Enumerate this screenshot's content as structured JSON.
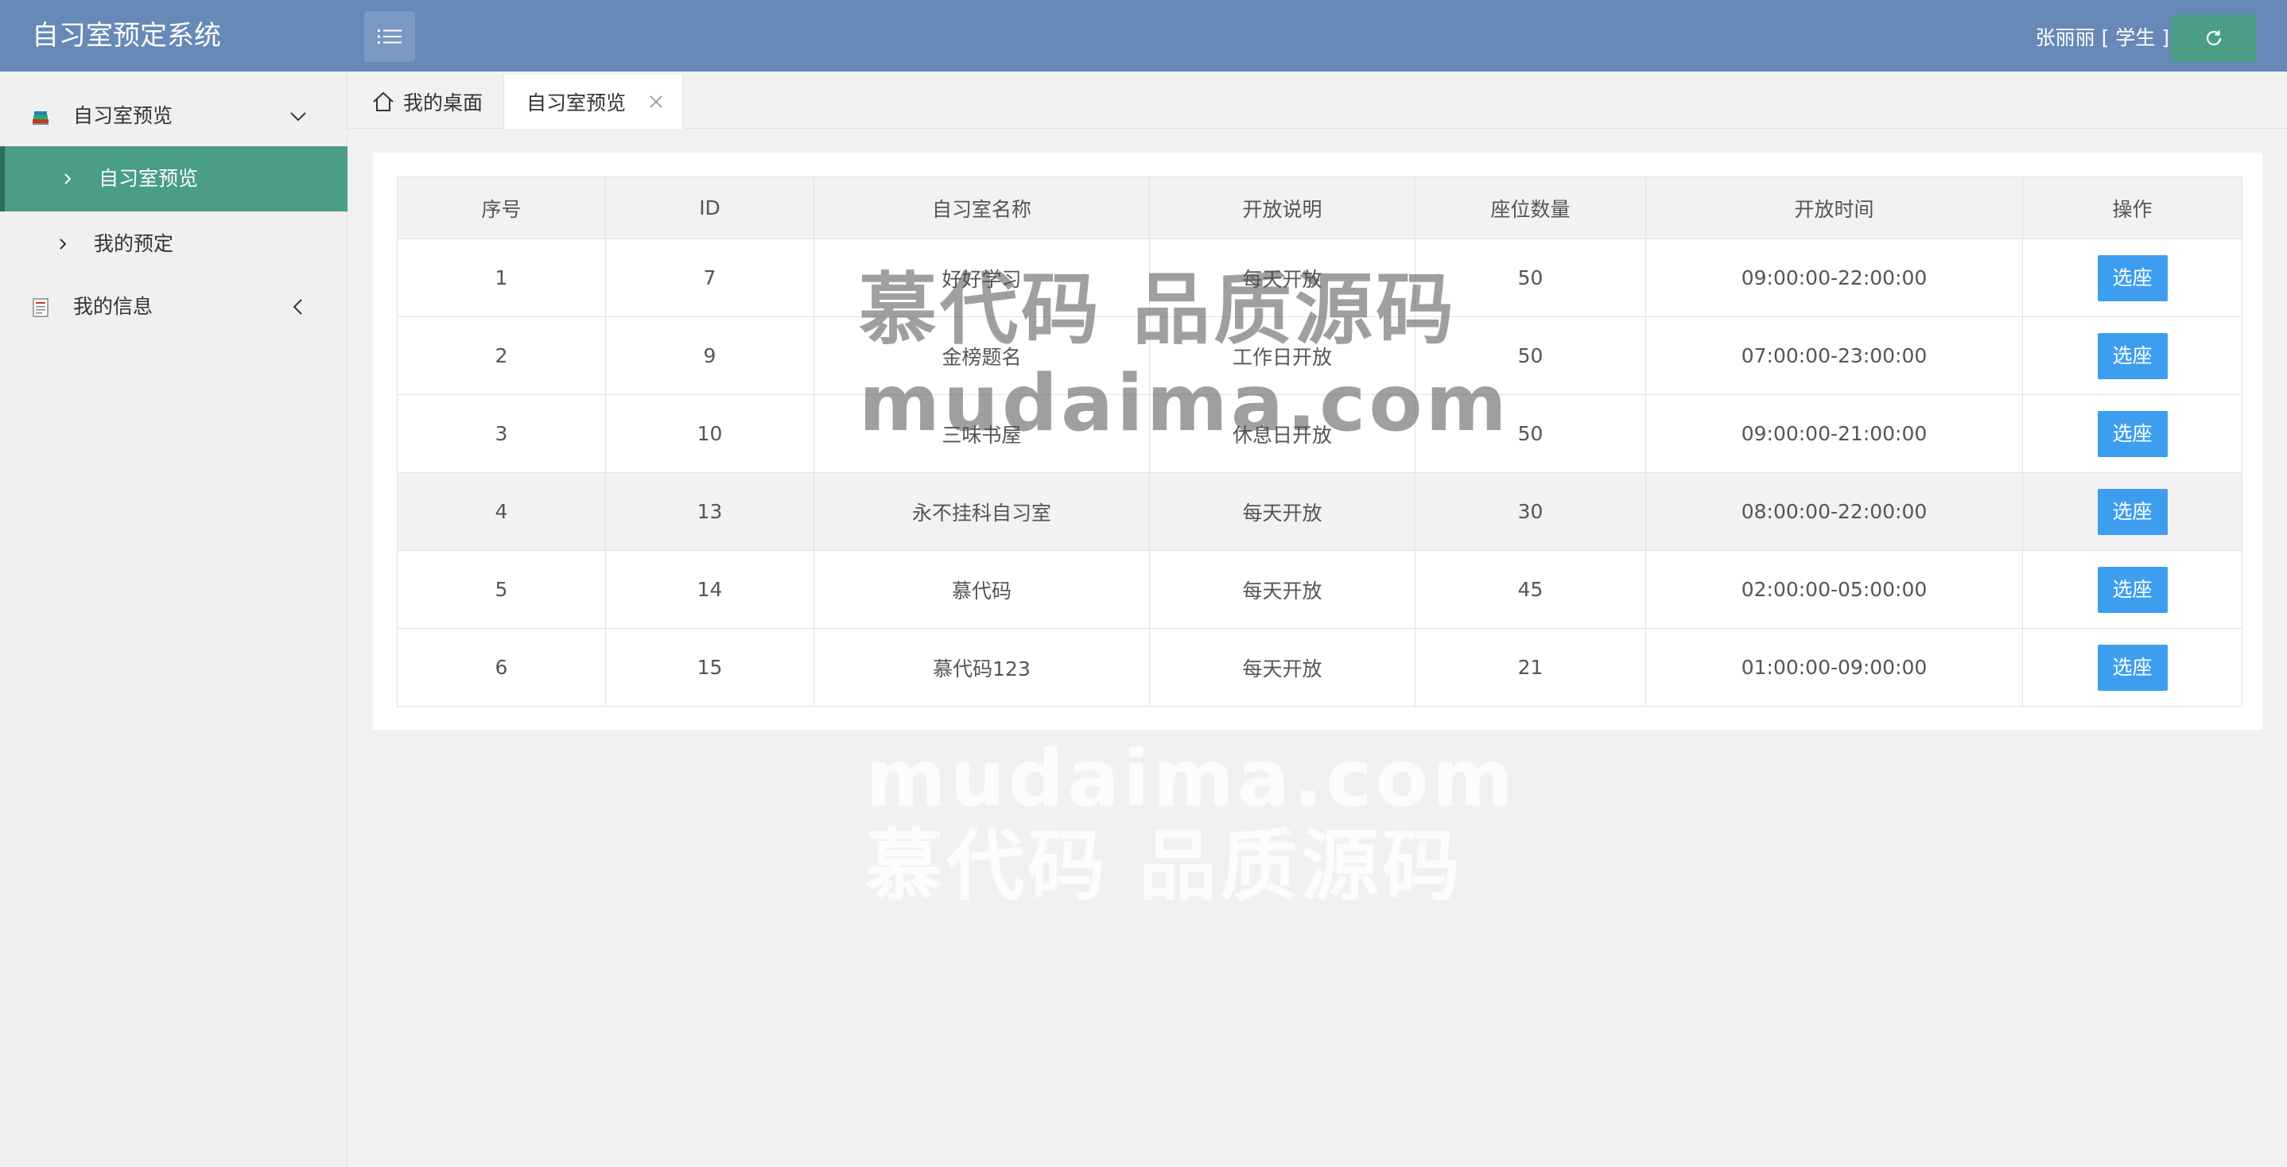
{
  "app": {
    "title": "自习室预定系统"
  },
  "header": {
    "user": "张丽丽 [ 学生 ]"
  },
  "sidebar": {
    "groups": [
      {
        "label": "自习室预览",
        "items": [
          {
            "label": "自习室预览",
            "active": true
          },
          {
            "label": "我的预定",
            "active": false
          }
        ]
      },
      {
        "label": "我的信息",
        "items": []
      }
    ]
  },
  "tabs": [
    {
      "label": "我的桌面"
    },
    {
      "label": "自习室预览",
      "active": true
    }
  ],
  "table": {
    "columns": [
      "序号",
      "ID",
      "自习室名称",
      "开放说明",
      "座位数量",
      "开放时间",
      "操作"
    ],
    "rows": [
      {
        "no": "1",
        "id": "7",
        "name": "好好学习",
        "desc": "每天开放",
        "seats": "50",
        "time": "09:00:00-22:00:00",
        "action": "选座"
      },
      {
        "no": "2",
        "id": "9",
        "name": "金榜题名",
        "desc": "工作日开放",
        "seats": "50",
        "time": "07:00:00-23:00:00",
        "action": "选座"
      },
      {
        "no": "3",
        "id": "10",
        "name": "三味书屋",
        "desc": "休息日开放",
        "seats": "50",
        "time": "09:00:00-21:00:00",
        "action": "选座"
      },
      {
        "no": "4",
        "id": "13",
        "name": "永不挂科自习室",
        "desc": "每天开放",
        "seats": "30",
        "time": "08:00:00-22:00:00",
        "action": "选座"
      },
      {
        "no": "5",
        "id": "14",
        "name": "慕代码",
        "desc": "每天开放",
        "seats": "45",
        "time": "02:00:00-05:00:00",
        "action": "选座"
      },
      {
        "no": "6",
        "id": "15",
        "name": "慕代码123",
        "desc": "每天开放",
        "seats": "21",
        "time": "01:00:00-09:00:00",
        "action": "选座"
      }
    ]
  },
  "watermark": {
    "line1": "慕代码 品质源码",
    "line2": "mudaima.com"
  },
  "colors": {
    "header": "#6689b7",
    "active_nav": "#4a9d86",
    "primary_button": "#3d9ef0"
  },
  "icons": {
    "menu_toggle": "list-icon",
    "refresh": "refresh-icon",
    "home_tab": "home-icon",
    "close_tab": "close-icon"
  }
}
